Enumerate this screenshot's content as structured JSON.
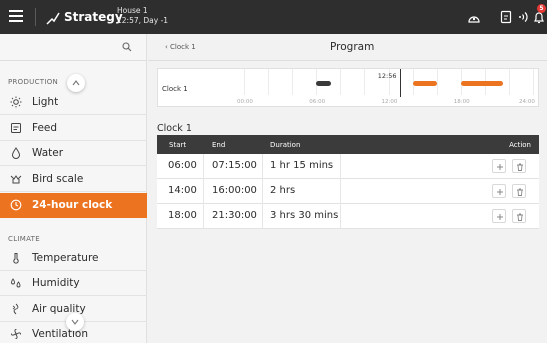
{
  "header": {
    "title": "Strategy",
    "house_name": "House 1",
    "house_time": "12:57, Day -1",
    "notification_count": "5",
    "icons": [
      "menu-icon",
      "strategy-icon",
      "dashboard-icon",
      "report-icon",
      "signal-icon",
      "bell-icon"
    ]
  },
  "sidebar": {
    "search_icon": "search-icon",
    "production_label": "PRODUCTION",
    "climate_label": "CLIMATE",
    "items": [
      {
        "label": "Light",
        "icon": "light-icon"
      },
      {
        "label": "Feed",
        "icon": "feed-icon"
      },
      {
        "label": "Water",
        "icon": "water-icon"
      },
      {
        "label": "Bird scale",
        "icon": "bird-scale-icon"
      },
      {
        "label": "24-hour clock",
        "icon": "clock-icon",
        "active": true
      },
      {
        "label": "Temperature",
        "icon": "thermometer-icon"
      },
      {
        "label": "Humidity",
        "icon": "humidity-icon"
      },
      {
        "label": "Air quality",
        "icon": "air-quality-icon"
      },
      {
        "label": "Ventilation",
        "icon": "ventilation-icon"
      }
    ]
  },
  "main": {
    "breadcrumb": "‹ Clock 1",
    "page_title": "Program",
    "timeline": {
      "label": "Clock 1",
      "now_label": "12:56",
      "axis_labels": [
        "00:00",
        "06:00",
        "12:00",
        "18:00",
        "24:00"
      ]
    },
    "table_title": "Clock 1",
    "columns": {
      "start": "Start",
      "end": "End",
      "duration": "Duration",
      "action": "Action"
    },
    "rows": [
      {
        "start": "06:00",
        "end": "07:15:00",
        "duration": "1 hr 15 mins"
      },
      {
        "start": "14:00",
        "end": "16:00:00",
        "duration": "2 hrs"
      },
      {
        "start": "18:00",
        "end": "21:30:00",
        "duration": "3 hrs 30 mins"
      }
    ]
  },
  "chart_data": {
    "type": "timeline",
    "title": "Clock 1",
    "x_range_hours": [
      0,
      24
    ],
    "current_time": "12:56",
    "series": [
      {
        "start": "06:00",
        "end": "07:15",
        "color": "#3a3a3a"
      },
      {
        "start": "14:00",
        "end": "16:00",
        "color": "#ec7320"
      },
      {
        "start": "18:00",
        "end": "21:30",
        "color": "#ec7320"
      }
    ]
  },
  "colors": {
    "accent": "#ec7320",
    "topbar": "#2e2e2e",
    "badge": "#e53935"
  }
}
